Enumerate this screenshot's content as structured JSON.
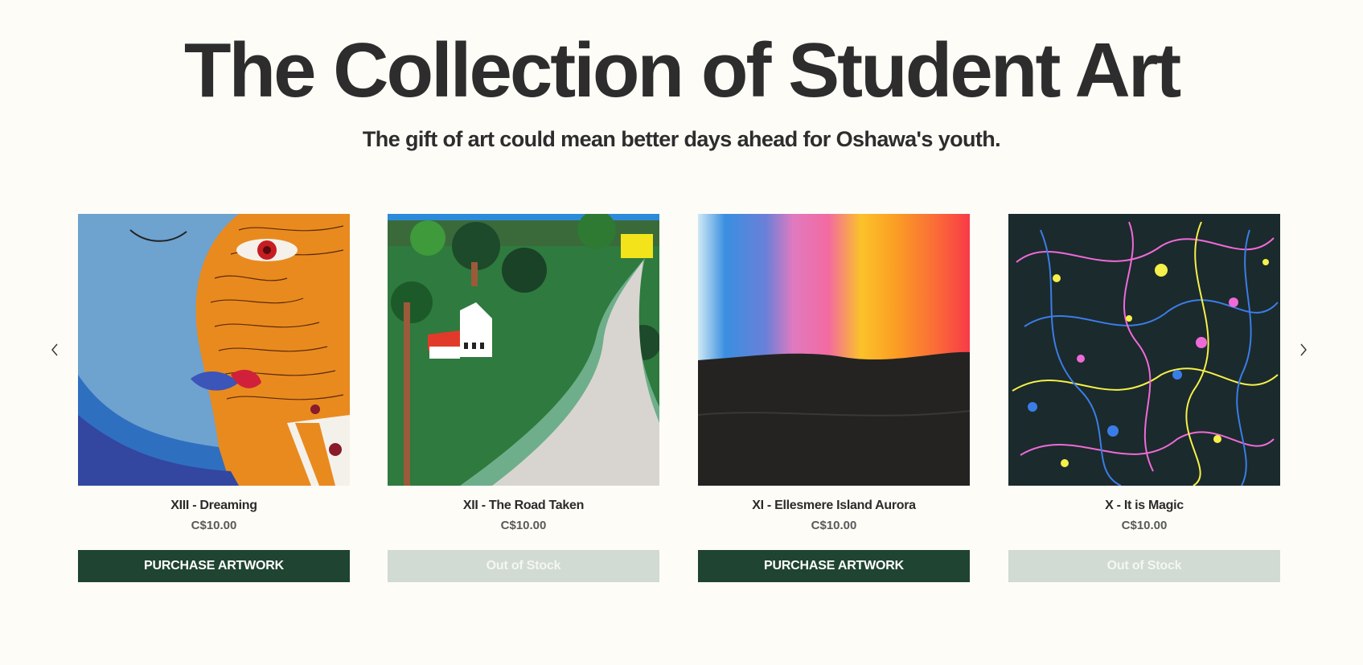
{
  "header": {
    "title": "The Collection of Student Art",
    "subtitle": "The gift of art could mean better days ahead for Oshawa's youth."
  },
  "carousel": {
    "prev_icon": "chevron-left-icon",
    "next_icon": "chevron-right-icon",
    "items": [
      {
        "name": "XIII - Dreaming",
        "price": "C$10.00",
        "button": "PURCHASE ARTWORK",
        "in_stock": true
      },
      {
        "name": "XII - The Road Taken",
        "price": "C$10.00",
        "button": "Out of Stock",
        "in_stock": false
      },
      {
        "name": "XI - Ellesmere Island Aurora",
        "price": "C$10.00",
        "button": "PURCHASE ARTWORK",
        "in_stock": true
      },
      {
        "name": "X - It is Magic",
        "price": "C$10.00",
        "button": "Out of Stock",
        "in_stock": false
      }
    ]
  },
  "colors": {
    "background": "#fdfcf7",
    "primary_button": "#1f4431",
    "disabled_button": "#d1dad3",
    "text": "#2d2d2d"
  }
}
